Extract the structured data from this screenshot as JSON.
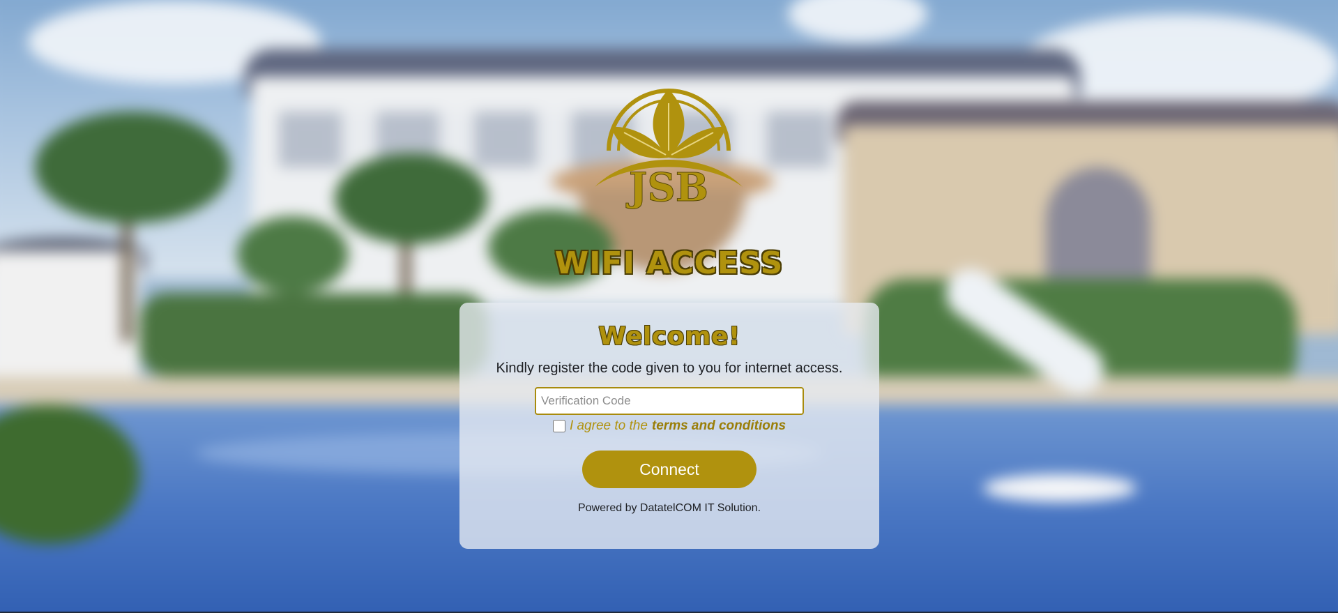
{
  "brand": {
    "logo_text": "JSB",
    "accent_color": "#b0920e"
  },
  "header": {
    "title": "WIFI ACCESS"
  },
  "card": {
    "welcome": "Welcome!",
    "instruction": "Kindly register the code given to you for internet access.",
    "code_input": {
      "placeholder": "Verification Code",
      "value": ""
    },
    "agree_text": "I agree to the",
    "terms_link": "terms and conditions",
    "connect_label": "Connect",
    "powered_by": "Powered by DatatelCOM IT Solution."
  },
  "icons": {
    "logo": "lotus-leaves-emblem"
  }
}
